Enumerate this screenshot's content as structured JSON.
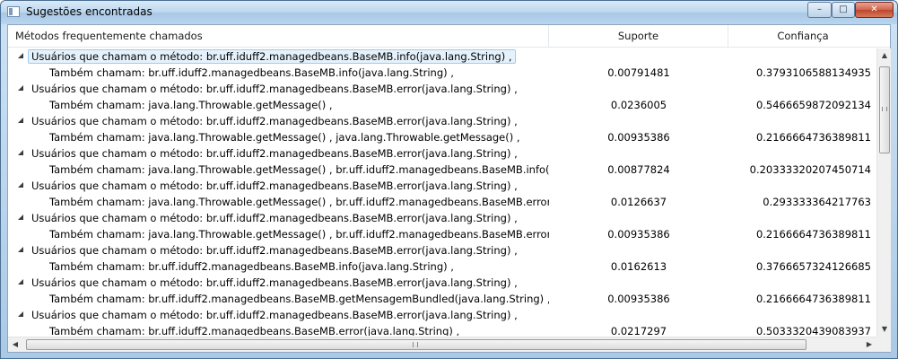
{
  "window": {
    "title": "Sugestões encontradas",
    "minimize_glyph": "–",
    "maximize_glyph": "□",
    "close_glyph": "✕"
  },
  "columns": [
    "Métodos frequentemente chamados",
    "Suporte",
    "Confiança"
  ],
  "rows": [
    {
      "type": "parent",
      "text": "Usuários que chamam o método: br.uff.iduff2.managedbeans.BaseMB.info(java.lang.String) ,",
      "support": "",
      "confidence": ""
    },
    {
      "type": "child",
      "text": "Também chamam: br.uff.iduff2.managedbeans.BaseMB.info(java.lang.String) ,",
      "support": "0.00791481",
      "confidence": "0.3793106588134935"
    },
    {
      "type": "parent",
      "text": "Usuários que chamam o método: br.uff.iduff2.managedbeans.BaseMB.error(java.lang.String) ,",
      "support": "",
      "confidence": ""
    },
    {
      "type": "child",
      "text": "Também chamam: java.lang.Throwable.getMessage() ,",
      "support": "0.0236005",
      "confidence": "0.5466659872092134"
    },
    {
      "type": "parent",
      "text": "Usuários que chamam o método: br.uff.iduff2.managedbeans.BaseMB.error(java.lang.String) ,",
      "support": "",
      "confidence": ""
    },
    {
      "type": "child",
      "text": "Também chamam: java.lang.Throwable.getMessage() , java.lang.Throwable.getMessage() ,",
      "support": "0.00935386",
      "confidence": "0.2166664736389811"
    },
    {
      "type": "parent",
      "text": "Usuários que chamam o método: br.uff.iduff2.managedbeans.BaseMB.error(java.lang.String) ,",
      "support": "",
      "confidence": ""
    },
    {
      "type": "child",
      "text": "Também chamam: java.lang.Throwable.getMessage() , br.uff.iduff2.managedbeans.BaseMB.info(java.lang",
      "support": "0.00877824",
      "confidence": "0.20333320207450714"
    },
    {
      "type": "parent",
      "text": "Usuários que chamam o método: br.uff.iduff2.managedbeans.BaseMB.error(java.lang.String) ,",
      "support": "",
      "confidence": ""
    },
    {
      "type": "child",
      "text": "Também chamam: java.lang.Throwable.getMessage() , br.uff.iduff2.managedbeans.BaseMB.error(java.lan",
      "support": "0.0126637",
      "confidence": "0.293333364217763"
    },
    {
      "type": "parent",
      "text": "Usuários que chamam o método: br.uff.iduff2.managedbeans.BaseMB.error(java.lang.String) ,",
      "support": "",
      "confidence": ""
    },
    {
      "type": "child",
      "text": "Também chamam: java.lang.Throwable.getMessage() , br.uff.iduff2.managedbeans.BaseMB.error(java.lan",
      "support": "0.00935386",
      "confidence": "0.2166664736389811"
    },
    {
      "type": "parent",
      "text": "Usuários que chamam o método: br.uff.iduff2.managedbeans.BaseMB.error(java.lang.String) ,",
      "support": "",
      "confidence": ""
    },
    {
      "type": "child",
      "text": "Também chamam: br.uff.iduff2.managedbeans.BaseMB.info(java.lang.String) ,",
      "support": "0.0162613",
      "confidence": "0.3766657324126685"
    },
    {
      "type": "parent",
      "text": "Usuários que chamam o método: br.uff.iduff2.managedbeans.BaseMB.error(java.lang.String) ,",
      "support": "",
      "confidence": ""
    },
    {
      "type": "child",
      "text": "Também chamam: br.uff.iduff2.managedbeans.BaseMB.getMensagemBundled(java.lang.String) ,",
      "support": "0.00935386",
      "confidence": "0.2166664736389811"
    },
    {
      "type": "parent",
      "text": "Usuários que chamam o método: br.uff.iduff2.managedbeans.BaseMB.error(java.lang.String) ,",
      "support": "",
      "confidence": ""
    },
    {
      "type": "child",
      "text": "Também chamam: br.uff.iduff2.managedbeans.BaseMB.error(java.lang.String) ,",
      "support": "0.0217297",
      "confidence": "0.5033320439083937"
    }
  ],
  "scroll": {
    "up_glyph": "▲",
    "down_glyph": "▼",
    "left_glyph": "◀",
    "right_glyph": "▶"
  }
}
